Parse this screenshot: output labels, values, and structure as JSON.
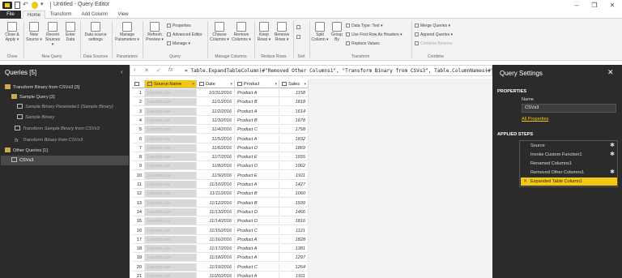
{
  "window": {
    "title": "Untitled - Query Editor",
    "qa_undo": "↶",
    "qa_dropdown": "▾",
    "min": "–",
    "max": "❐",
    "close": "✕"
  },
  "tabs": [
    "File",
    "Home",
    "Transform",
    "Add Column",
    "View"
  ],
  "ribbon": {
    "close_apply": "Close &",
    "close_apply2": "Apply ▾",
    "new_source": "New",
    "new_source2": "Source ▾",
    "recent_sources": "Recent",
    "recent_sources2": "Sources ▾",
    "enter_data": "Enter",
    "enter_data2": "Data",
    "data_source_settings": "Data source",
    "data_source_settings2": "settings",
    "manage_parameters": "Manage",
    "manage_parameters2": "Parameters ▾",
    "refresh_preview": "Refresh",
    "refresh_preview2": "Preview ▾",
    "properties": "Properties",
    "advanced_editor": "Advanced Editor",
    "manage": "Manage ▾",
    "choose_columns": "Choose",
    "choose_columns2": "Columns ▾",
    "remove_columns": "Remove",
    "remove_columns2": "Columns ▾",
    "keep_rows": "Keep",
    "keep_rows2": "Rows ▾",
    "remove_rows": "Remove",
    "remove_rows2": "Rows ▾",
    "split_column": "Split",
    "split_column2": "Column ▾",
    "group_by": "Group",
    "group_by2": "By",
    "data_type": "Data Type: Text ▾",
    "use_first_row": "Use First Row As Headers ▾",
    "replace_values": "Replace Values",
    "merge_queries": "Merge Queries ▾",
    "append_queries": "Append Queries ▾",
    "combine_binaries": "Combine Binaries",
    "groups": [
      "Close",
      "New Query",
      "Data Sources",
      "Parameters",
      "Query",
      "Manage Columns",
      "Reduce Rows",
      "Sort",
      "Transform",
      "Combine"
    ]
  },
  "formula": {
    "collapse": "‹",
    "x": "✕",
    "check": "✓",
    "fx": "fx",
    "text": "= Table.ExpandTableColumn(#\"Removed Other Columns1\", \"Transform Binary from CSVs3\", Table.ColumnNames(#\"Removed",
    "expand": "⌄"
  },
  "queries": {
    "header": "Queries [5]",
    "collapse": "‹",
    "items": [
      "Transform Binary from CSVs3 [3]",
      "Sample Query [2]",
      "Sample Binary Parameter1 (Sample Binary)",
      "Sample Binary",
      "Transform Sample Binary from CSVs3",
      "Transform Binary from CSVs3",
      "Other Queries [1]",
      "CSVs3"
    ]
  },
  "grid": {
    "columns": [
      "Source.Name",
      "Date",
      "Product",
      "Sales"
    ],
    "rows": [
      [
        "London.csv",
        "10/31/2016",
        "Product A",
        "1158"
      ],
      [
        "London.csv",
        "11/1/2016",
        "Product B",
        "1818"
      ],
      [
        "London.csv",
        "11/2/2016",
        "Product A",
        "1614"
      ],
      [
        "London.csv",
        "11/3/2016",
        "Product B",
        "1678"
      ],
      [
        "London.csv",
        "11/4/2016",
        "Product C",
        "1758"
      ],
      [
        "London.csv",
        "11/5/2016",
        "Product A",
        "1832"
      ],
      [
        "London.csv",
        "11/6/2016",
        "Product D",
        "1869"
      ],
      [
        "London.csv",
        "11/7/2016",
        "Product E",
        "1555"
      ],
      [
        "London.csv",
        "11/8/2016",
        "Product D",
        "1062"
      ],
      [
        "London.csv",
        "11/9/2016",
        "Product E",
        "1911"
      ],
      [
        "London.csv",
        "11/10/2016",
        "Product A",
        "1427"
      ],
      [
        "London.csv",
        "11/11/2016",
        "Product B",
        "1060"
      ],
      [
        "London.csv",
        "11/12/2016",
        "Product B",
        "1599"
      ],
      [
        "London.csv",
        "11/13/2016",
        "Product D",
        "1466"
      ],
      [
        "London.csv",
        "11/14/2016",
        "Product D",
        "1816"
      ],
      [
        "London.csv",
        "11/15/2016",
        "Product C",
        "1121"
      ],
      [
        "London.csv",
        "11/16/2016",
        "Product A",
        "1828"
      ],
      [
        "London.csv",
        "11/17/2016",
        "Product A",
        "1381"
      ],
      [
        "London.csv",
        "11/18/2016",
        "Product A",
        "1297"
      ],
      [
        "London.csv",
        "11/19/2016",
        "Product C",
        "1264"
      ],
      [
        "London.csv",
        "11/20/2016",
        "Product A",
        "1911"
      ]
    ]
  },
  "settings": {
    "title": "Query Settings",
    "close": "✕",
    "properties_header": "PROPERTIES",
    "name_label": "Name",
    "name_value": "CSVs3",
    "all_properties": "All Properties",
    "applied_steps_header": "APPLIED STEPS",
    "steps": [
      "Source",
      "Invoke Custom Function1",
      "Renamed Columns1",
      "Removed Other Columns1",
      "Expanded Table Column1"
    ],
    "gear": "✱",
    "delete_mark": "✕"
  },
  "colors": {
    "accent": "#f2c811",
    "dark_pane": "#2b2b2b",
    "ribbon_bg": "#f3f3f3"
  }
}
